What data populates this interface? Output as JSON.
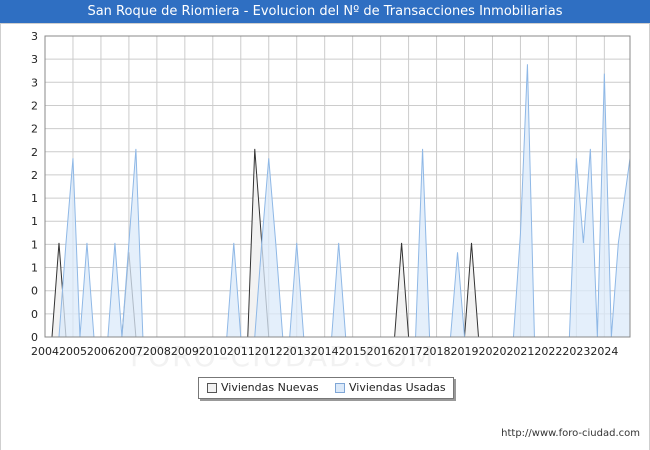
{
  "title": "San Roque de Riomiera - Evolucion del Nº de Transacciones Inmobiliarias",
  "source": "http://www.foro-ciudad.com",
  "watermark": "FORO-CIUDAD.COM",
  "colors": {
    "title_bg": "#2f6fc2",
    "nuevas_fill": "#f2f2f2",
    "nuevas_stroke": "#333333",
    "usadas_fill": "#dbe9f9",
    "usadas_stroke": "#8fb8e6",
    "grid": "#cccccc"
  },
  "chart_data": {
    "type": "area",
    "title": "San Roque de Riomiera - Evolucion del Nº de Transacciones Inmobiliarias",
    "xlabel": "",
    "ylabel": "",
    "ylim": [
      0,
      3.2
    ],
    "xlim": [
      2004,
      2024.917
    ],
    "y_tick_labels": [
      "0",
      "0",
      "0",
      "1",
      "1",
      "1",
      "1",
      "2",
      "2",
      "2",
      "2",
      "3",
      "3",
      "3"
    ],
    "x_tick_labels": [
      "2004",
      "2005",
      "2006",
      "2007",
      "2008",
      "2009",
      "2010",
      "2011",
      "2012",
      "2013",
      "2014",
      "2015",
      "2016",
      "2017",
      "2018",
      "2019",
      "2020",
      "2021",
      "2022",
      "2023",
      "2024"
    ],
    "grid": true,
    "legend_position": "bottom",
    "series": [
      {
        "name": "Viviendas Nuevas",
        "points": [
          [
            2004,
            0
          ],
          [
            2004.25,
            0
          ],
          [
            2004.5,
            1
          ],
          [
            2004.75,
            0
          ],
          [
            2006.75,
            0
          ],
          [
            2007,
            0.9
          ],
          [
            2007.25,
            0
          ],
          [
            2011.25,
            0
          ],
          [
            2011.5,
            2
          ],
          [
            2011.75,
            1
          ],
          [
            2012,
            0
          ],
          [
            2016.5,
            0
          ],
          [
            2016.75,
            1
          ],
          [
            2017,
            0
          ],
          [
            2019,
            0
          ],
          [
            2019.25,
            1
          ],
          [
            2019.5,
            0
          ],
          [
            2024.917,
            0
          ]
        ]
      },
      {
        "name": "Viviendas Usadas",
        "points": [
          [
            2004,
            0
          ],
          [
            2004.5,
            0
          ],
          [
            2004.75,
            1
          ],
          [
            2005,
            1.9
          ],
          [
            2005.25,
            0
          ],
          [
            2005.5,
            1
          ],
          [
            2005.75,
            0
          ],
          [
            2006.25,
            0
          ],
          [
            2006.5,
            1
          ],
          [
            2006.75,
            0
          ],
          [
            2007,
            1
          ],
          [
            2007.25,
            2
          ],
          [
            2007.5,
            0
          ],
          [
            2010.5,
            0
          ],
          [
            2010.75,
            1
          ],
          [
            2011,
            0
          ],
          [
            2011.5,
            0
          ],
          [
            2011.75,
            1
          ],
          [
            2012,
            1.9
          ],
          [
            2012.25,
            1
          ],
          [
            2012.5,
            0
          ],
          [
            2012.75,
            0
          ],
          [
            2013,
            1
          ],
          [
            2013.25,
            0
          ],
          [
            2014.25,
            0
          ],
          [
            2014.5,
            1
          ],
          [
            2014.75,
            0
          ],
          [
            2017.25,
            0
          ],
          [
            2017.5,
            2
          ],
          [
            2017.75,
            0
          ],
          [
            2018.5,
            0
          ],
          [
            2018.75,
            0.9
          ],
          [
            2019,
            0
          ],
          [
            2020.75,
            0
          ],
          [
            2021,
            1.1
          ],
          [
            2021.25,
            2.9
          ],
          [
            2021.5,
            0
          ],
          [
            2022.75,
            0
          ],
          [
            2023,
            1.9
          ],
          [
            2023.25,
            1
          ],
          [
            2023.5,
            2
          ],
          [
            2023.75,
            0
          ],
          [
            2024,
            2.8
          ],
          [
            2024.25,
            0
          ],
          [
            2024.5,
            1
          ],
          [
            2024.917,
            1.9
          ]
        ]
      }
    ]
  }
}
